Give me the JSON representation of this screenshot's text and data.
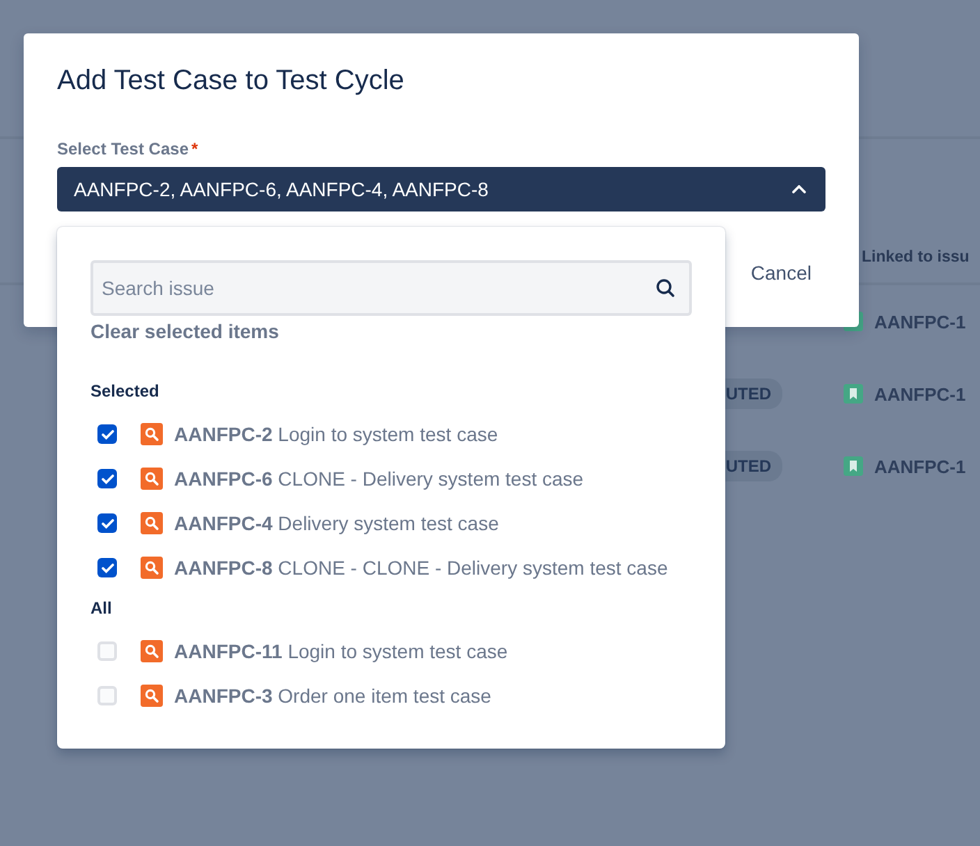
{
  "background": {
    "column_header": "Linked to issu",
    "rows": [
      {
        "linked": "AANFPC-1"
      },
      {
        "status": "UTED",
        "linked": "AANFPC-1"
      },
      {
        "status": "UTED",
        "linked": "AANFPC-1"
      }
    ]
  },
  "dialog": {
    "title": "Add Test Case to Test Cycle",
    "field_label": "Select Test Case",
    "required_mark": "*",
    "value": "AANFPC-2, AANFPC-6, AANFPC-4, AANFPC-8",
    "expanded": true,
    "cancel": "Cancel"
  },
  "dropdown": {
    "search": {
      "placeholder": "Search issue"
    },
    "clear_label": "Clear selected items",
    "groups": [
      {
        "heading": "Selected",
        "items": [
          {
            "key": "AANFPC-2",
            "summary": "Login to system test case",
            "checked": true
          },
          {
            "key": "AANFPC-6",
            "summary": "CLONE - Delivery system test case",
            "checked": true
          },
          {
            "key": "AANFPC-4",
            "summary": "Delivery system test case",
            "checked": true
          },
          {
            "key": "AANFPC-8",
            "summary": "CLONE - CLONE - Delivery system test case",
            "checked": true
          }
        ]
      },
      {
        "heading": "All",
        "items": [
          {
            "key": "AANFPC-11",
            "summary": "Login to system test case",
            "checked": false
          },
          {
            "key": "AANFPC-3",
            "summary": "Order one item test case",
            "checked": false
          }
        ]
      }
    ]
  }
}
